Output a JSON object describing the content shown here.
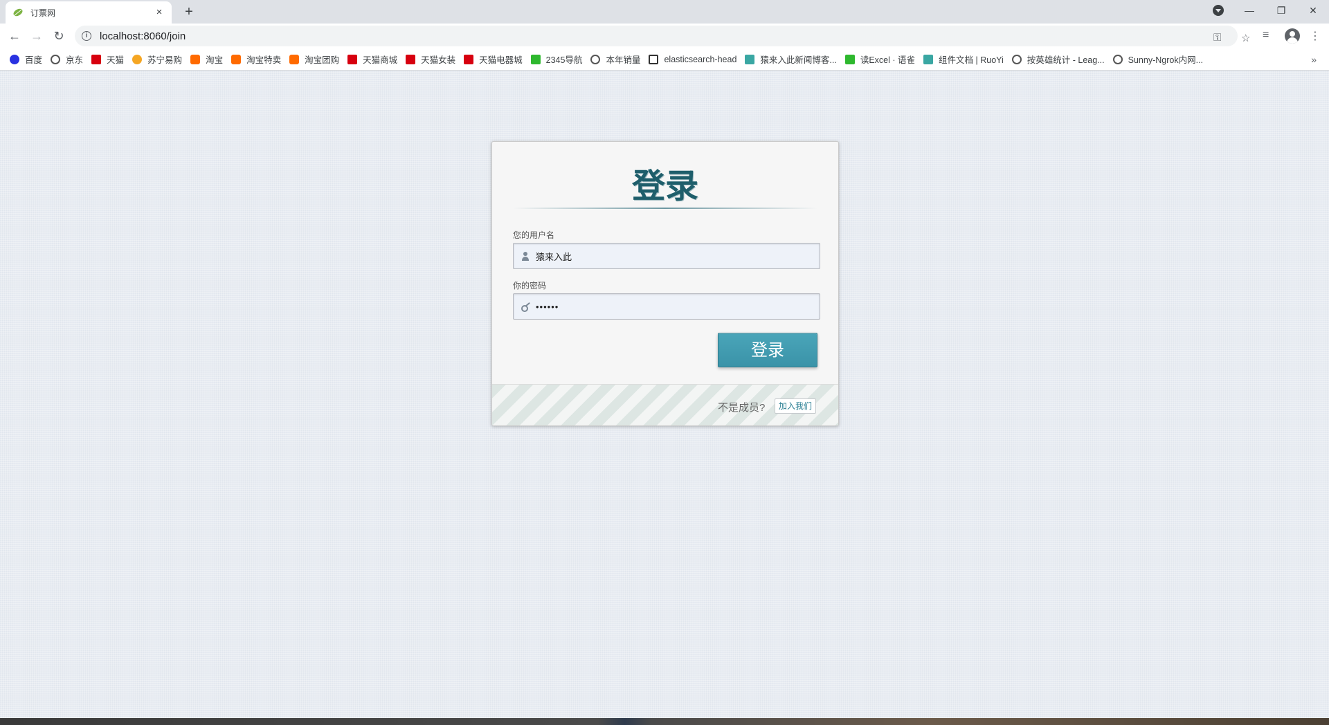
{
  "browser": {
    "tab_title": "订票网",
    "tab_close": "×",
    "new_tab": "+",
    "url": "localhost:8060/join",
    "bookmarks": [
      {
        "label": "百度",
        "icon": "baidu"
      },
      {
        "label": "京东",
        "icon": "globe"
      },
      {
        "label": "天猫",
        "icon": "tmall"
      },
      {
        "label": "苏宁易购",
        "icon": "suning"
      },
      {
        "label": "淘宝",
        "icon": "taobao"
      },
      {
        "label": "淘宝特卖",
        "icon": "taobao"
      },
      {
        "label": "淘宝团购",
        "icon": "taobao"
      },
      {
        "label": "天猫商城",
        "icon": "tmall"
      },
      {
        "label": "天猫女装",
        "icon": "tmall"
      },
      {
        "label": "天猫电器城",
        "icon": "tmall"
      },
      {
        "label": "2345导航",
        "icon": "green"
      },
      {
        "label": "本年销量",
        "icon": "globe"
      },
      {
        "label": "elasticsearch-head",
        "icon": "elastic"
      },
      {
        "label": "猿来入此新闻博客...",
        "icon": "teal"
      },
      {
        "label": "读Excel · 语雀",
        "icon": "green"
      },
      {
        "label": "组件文档 | RuoYi",
        "icon": "teal"
      },
      {
        "label": "按英雄统计 - Leag...",
        "icon": "globe"
      },
      {
        "label": "Sunny-Ngrok内网...",
        "icon": "globe"
      }
    ],
    "bookmarks_more": "»"
  },
  "login": {
    "title": "登录",
    "username_label": "您的用户名",
    "username_value": "猿来入此",
    "password_label": "你的密码",
    "password_value": "••••••",
    "submit_label": "登录",
    "footer_text": "不是成员?",
    "join_label": "加入我们"
  },
  "colors": {
    "accent": "#3a93a8",
    "title": "#1e5e6b"
  }
}
